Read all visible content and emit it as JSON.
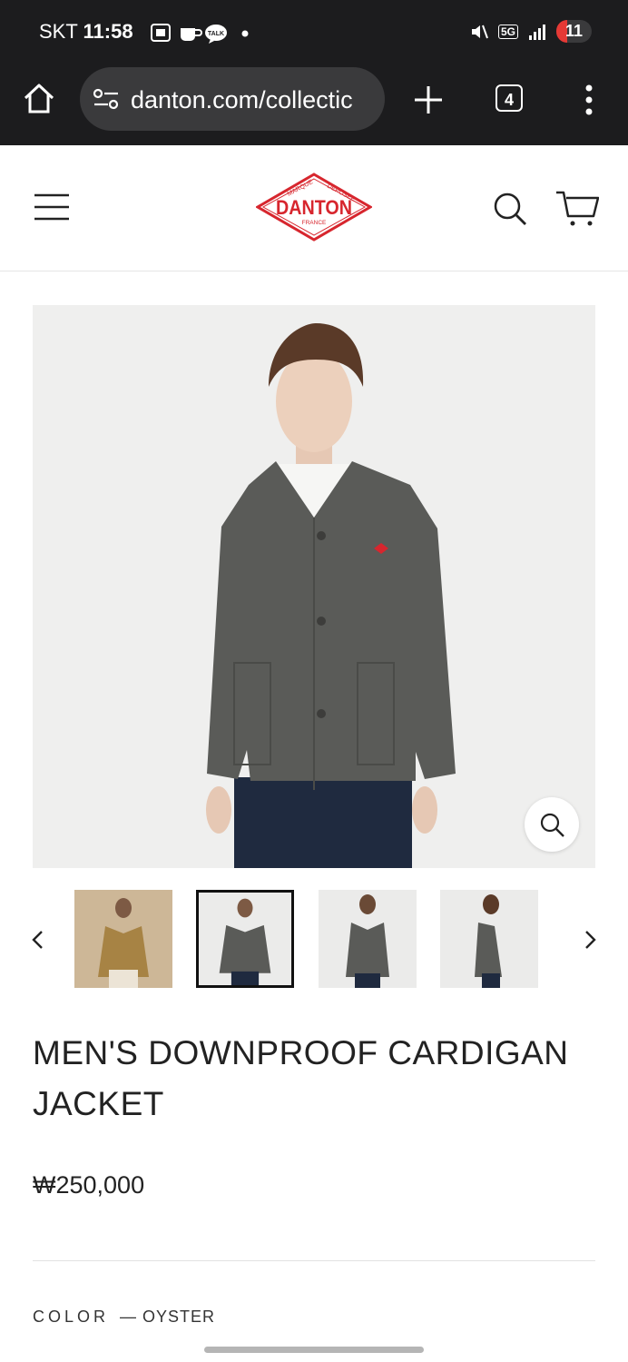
{
  "status_bar": {
    "carrier": "SKT",
    "time": "11:58",
    "battery": "11",
    "network": "5G"
  },
  "browser": {
    "url": "danton.com/collectic",
    "tab_count": "4"
  },
  "site": {
    "logo_top_left": "MARQUE",
    "logo_top_right": "DEPOSEE",
    "logo_main": "DANTON",
    "logo_bottom": "FRANCE"
  },
  "product": {
    "title": "MEN'S DOWNPROOF CARDIGAN JACKET",
    "price": "₩250,000",
    "color_label": "COLOR",
    "color_value": "— OYSTER",
    "thumbnails": [
      {
        "bg": "#cdb797",
        "jacket": "#a78344",
        "pants": "#ece4d6"
      },
      {
        "bg": "#ebebea",
        "jacket": "#5a5b58",
        "pants": "#1f2a3f"
      },
      {
        "bg": "#ebebea",
        "jacket": "#5a5b58",
        "pants": "#1f2a3f"
      },
      {
        "bg": "#ebebea",
        "jacket": "#5a5b58",
        "pants": "#1f2a3f"
      }
    ],
    "active_thumbnail": 1
  },
  "colors": {
    "brand_red": "#d7262e",
    "chrome_bg": "#1c1c1e"
  }
}
